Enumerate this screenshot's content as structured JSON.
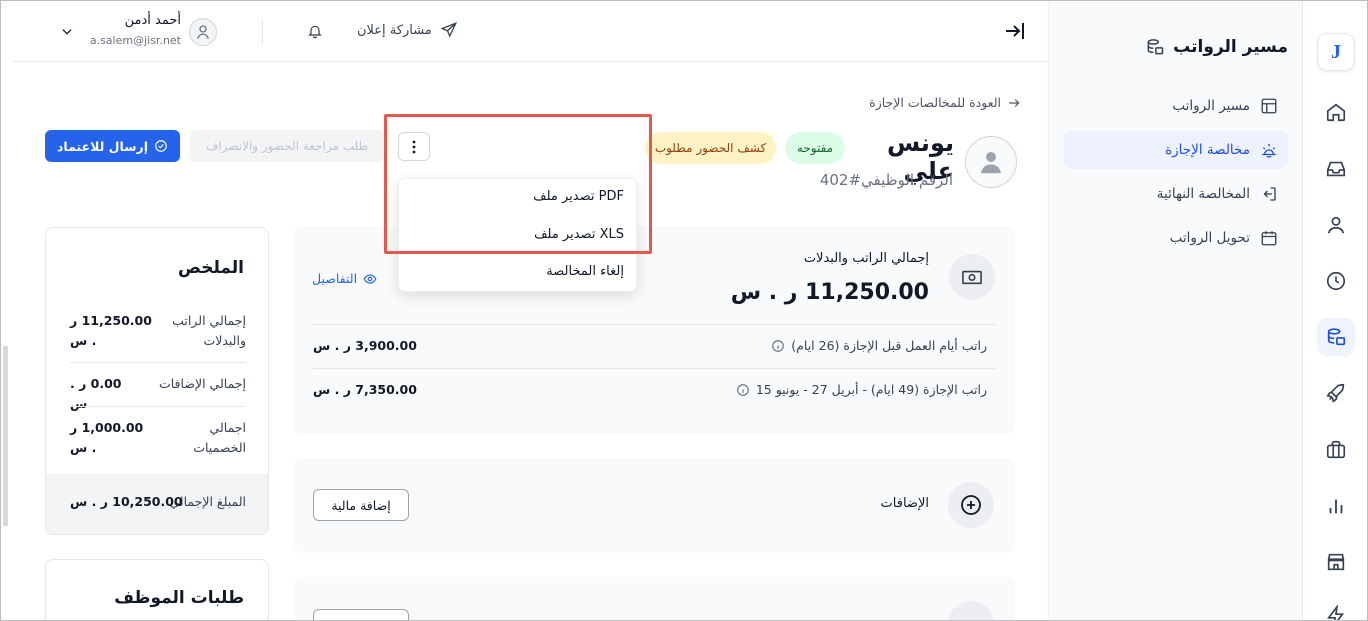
{
  "topbar": {
    "share_label": "مشاركة إعلان",
    "user_name": "أحمد أدمن",
    "user_email": "a.salem@jisr.net"
  },
  "sidenav": {
    "title": "مسير الرواتب",
    "items": [
      {
        "label": "مسير الرواتب",
        "active": false
      },
      {
        "label": "مخالصة الإجازة",
        "active": true
      },
      {
        "label": "المخالصة النهائية",
        "active": false
      },
      {
        "label": "تحويل الرواتب",
        "active": false
      }
    ]
  },
  "rail": {
    "logo": "J",
    "icons": [
      "home-icon",
      "inbox-icon",
      "user-icon",
      "clock-icon",
      "payroll-icon",
      "rocket-icon",
      "briefcase-icon",
      "chart-icon",
      "store-icon",
      "bolt-icon"
    ]
  },
  "header": {
    "back_label": "العودة للمخالصات الإجازة",
    "employee_name": "يونس علي",
    "employee_id": "الرقم الوظيفي#402",
    "status_badge": "مفتوحه",
    "attendance_badge": "كشف الحضور مطلوب",
    "send_button": "إرسال للاعتماد",
    "attendance_button": "طلب مراجعة الحضور والانصراف"
  },
  "dropdown": {
    "items": [
      "تصدير ملف PDF",
      "تصدير ملف XLS",
      "إلغاء المخالصة"
    ]
  },
  "salary": {
    "title": "إجمالي الراتب والبدلات",
    "amount": "11,250.00 ر . س",
    "details_label": "التفاصيل",
    "rows": [
      {
        "label": "راتب أيام العمل قبل الإجازة (26 ايام)",
        "value": "3,900.00 ر . س"
      },
      {
        "label": "راتب الإجازة (49 ايام) - أبريل 27 - يونيو 15",
        "value": "7,350.00 ر . س"
      }
    ]
  },
  "additions": {
    "title": "الإضافات",
    "button": "إضافة مالية"
  },
  "summary": {
    "title": "الملخص",
    "rows": [
      {
        "label": "إجمالي الراتب والبدلات",
        "value": "11,250.00 ر . س"
      },
      {
        "label": "إجمالي الإضافات",
        "value": "0.00 ر . س"
      },
      {
        "label": "اجمالي الخصميات",
        "value": "1,000.00 ر . س"
      }
    ],
    "total_label": "المبلغ الإجمالي",
    "total_value": "10,250.00 ر . س"
  },
  "requests": {
    "title": "طلبات الموظف"
  },
  "colors": {
    "accent": "#2563eb",
    "highlight": "#e05a4e"
  }
}
